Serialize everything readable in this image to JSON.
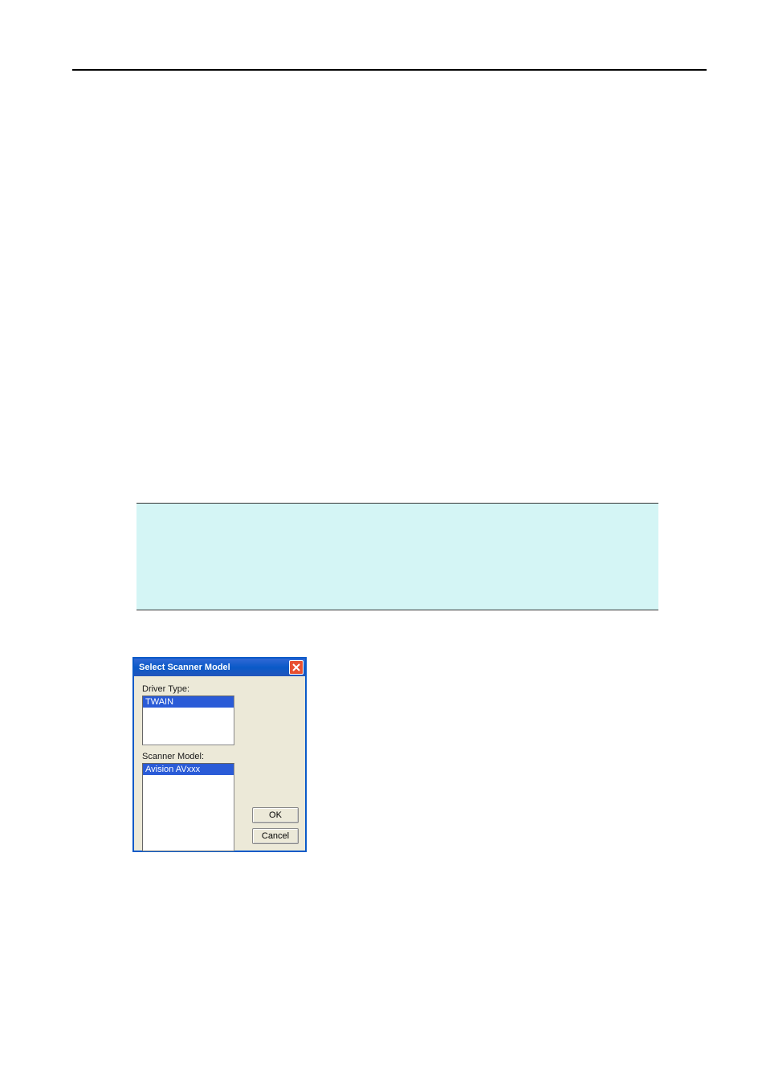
{
  "dialog": {
    "title": "Select Scanner Model",
    "driver_type_label": "Driver Type:",
    "driver_types": [
      "TWAIN"
    ],
    "driver_selected": "TWAIN",
    "scanner_model_label": "Scanner Model:",
    "scanner_models": [
      "Avision AVxxx"
    ],
    "scanner_selected": "Avision AVxxx",
    "ok_label": "OK",
    "cancel_label": "Cancel"
  }
}
